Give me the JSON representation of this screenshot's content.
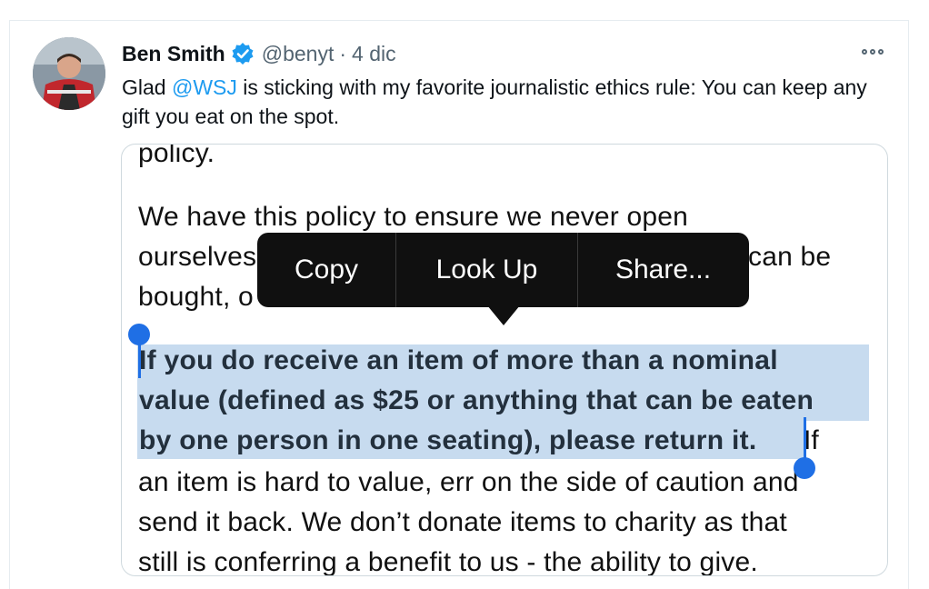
{
  "tweet": {
    "author_name": "Ben Smith",
    "handle": "@benyt",
    "separator": "·",
    "date": "4 dic",
    "text_before": "Glad ",
    "mention": "@WSJ",
    "text_after": " is sticking with my favorite journalistic ethics rule: You can keep any gift you eat on the spot."
  },
  "image": {
    "line_top": "policy.",
    "para1_line1": "We have this policy to ensure we never open",
    "para1_line2_start": "ourselves",
    "para1_line2_end": "can be",
    "para1_line3": "bought, o",
    "bold_line1": "If you do receive an item of more than a nominal",
    "bold_line2": "value (defined as $25 or anything that can be eaten",
    "bold_line3": "by one person in one seating), please return it.",
    "after_bold": " If",
    "para2_line4": "an item is hard to value, err on the side of caution and",
    "para2_line5": "send it back. We don’t donate items to charity as that",
    "para2_line6": "still is conferring a benefit to us - the ability to give."
  },
  "context_menu": {
    "items": [
      "Copy",
      "Look Up",
      "Share..."
    ]
  },
  "colors": {
    "link": "#1d9bf0",
    "selection": "#c7dbef",
    "selection_handle": "#1f6fe5",
    "menu_bg": "#101010"
  }
}
